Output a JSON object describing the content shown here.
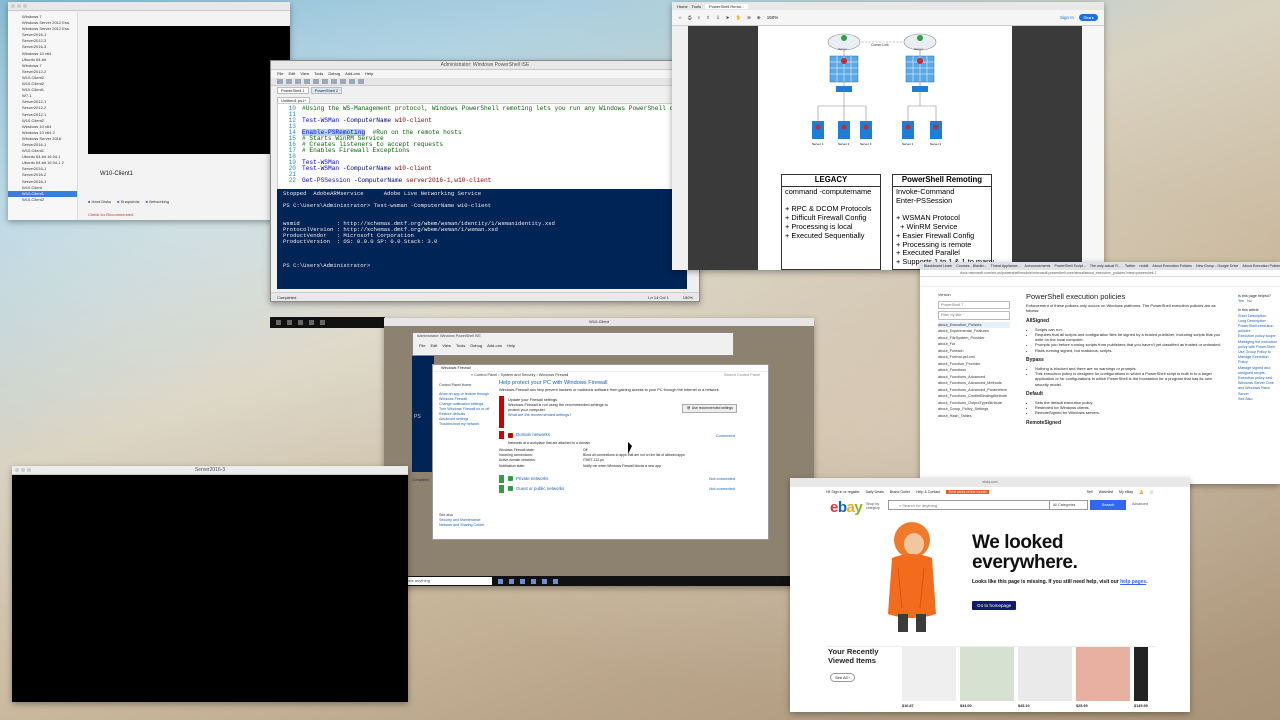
{
  "vm_manager": {
    "vm_list": [
      "Windows 7",
      "Windows Server 2012 Ess.",
      "Windows Server 2012 Ess.",
      "Server2016-1",
      "Server2012-3",
      "Server2016-3",
      "Windows 10 x64",
      "Ubuntu 64-bit",
      "Windows 7",
      "Server2012-2",
      "W10-Client2",
      "W10-Client2",
      "W10-Client1",
      "W7-1",
      "Server2012-1",
      "Server2012-2",
      "Server2012-1",
      "W10-Client2",
      "Windows 10 x64",
      "Windows 10 x64 2",
      "Windows Server 2016",
      "Server2016-1",
      "W10-Client1",
      "Ubuntu 64-bit 16.04.1",
      "Ubuntu 64-bit 16.04.1 2",
      "Server2016-1",
      "Server2016-2",
      "Server2016-1",
      "W10-Client",
      "W10-Client1",
      "W10-Client2"
    ],
    "selected_index": 29,
    "selected_vm": "W10-Client1",
    "details": [
      "Hard Disks",
      "Snapshots",
      "Networking"
    ],
    "details_note": "Check for Recommended"
  },
  "ps_ise": {
    "title": "Administrator: Windows PowerShell ISE",
    "menu": [
      "File",
      "Edit",
      "View",
      "Tools",
      "Debug",
      "Add-ons",
      "Help"
    ],
    "tabs": [
      "PowerShell 1",
      "PowerShell 2"
    ],
    "file_tab": "Untitled1.ps1*",
    "script_lines": [
      {
        "no": "10",
        "parts": [
          {
            "t": "#Using the WS-Management protocol, Windows PowerShell remoting lets you run any Windows PowerShell command on one",
            "c": "cm"
          }
        ]
      },
      {
        "no": "11",
        "parts": []
      },
      {
        "no": "12",
        "parts": [
          {
            "t": "Test-WSMan",
            "c": "cmd"
          },
          {
            "t": " -ComputerName ",
            "c": "par"
          },
          {
            "t": "w10-client",
            "c": "str"
          }
        ]
      },
      {
        "no": "13",
        "parts": []
      },
      {
        "no": "14",
        "parts": [
          {
            "t": "Enable-PSRemoting",
            "c": "cmd hl"
          },
          {
            "t": "  #Run on the remote hosts",
            "c": "cm"
          }
        ]
      },
      {
        "no": "15",
        "parts": [
          {
            "t": "# Starts WinRM Service",
            "c": "cm"
          }
        ]
      },
      {
        "no": "16",
        "parts": [
          {
            "t": "# Creates listeners to accept requests",
            "c": "cm"
          }
        ]
      },
      {
        "no": "17",
        "parts": [
          {
            "t": "# Enables Firewall Exceptions",
            "c": "cm"
          }
        ]
      },
      {
        "no": "18",
        "parts": []
      },
      {
        "no": "19",
        "parts": [
          {
            "t": "Test-WSMan",
            "c": "cmd"
          }
        ]
      },
      {
        "no": "20",
        "parts": [
          {
            "t": "Test-WSMan",
            "c": "cmd"
          },
          {
            "t": " -ComputerName ",
            "c": "par"
          },
          {
            "t": "w10-client",
            "c": "str"
          }
        ]
      },
      {
        "no": "21",
        "parts": []
      },
      {
        "no": "22",
        "parts": [
          {
            "t": "Get-PSSession",
            "c": "cmd"
          },
          {
            "t": " -ComputerName ",
            "c": "par"
          },
          {
            "t": "server2016-1,w10-client",
            "c": "str"
          }
        ]
      }
    ],
    "console": "Stopped  AdobeARMservice      Adobe Live Networking Service\n\nPS C:\\Users\\Administrator> Test-wsman -ComputerName w10-client\n\n\nwsmid           : http://schemas.dmtf.org/wbem/wsman/identity/1/wsmanidentity.xsd\nProtocolVersion : http://schemas.dmtf.org/wbem/wsman/1/wsman.xsd\nProductVendor   : Microsoft Corporation\nProductVersion  : OS: 0.0.0 SP: 0.0 Stack: 3.0\n\n\n\nPS C:\\Users\\Administrator> ",
    "status_left": "Completed",
    "status_pos": "Ln 14  Col 1",
    "status_zoom": "150%"
  },
  "pdf": {
    "tabs": [
      "Home",
      "Tools",
      "PowerShell Remo..."
    ],
    "zoom": "150%",
    "sign_in": "Sign In",
    "share": "Share",
    "diagram_labels": {
      "center_link": "Comm Link",
      "server_left": "Server",
      "server_right": "Server",
      "legacy_servers": [
        "Server 1",
        "Server 2",
        "Server 3"
      ],
      "ps_servers": [
        "Server 1",
        "Server 2"
      ]
    },
    "legacy": {
      "title": "LEGACY",
      "lines": [
        "command -computername",
        "",
        "+ RPC & DCOM Protocols",
        "+ Difficult Firewall Config",
        "+ Processing is local",
        "+ Executed Sequentially"
      ]
    },
    "psremoting": {
      "title": "PowerShell Remoting",
      "lines": [
        "Invoke-Command",
        "Enter-PSSession",
        "",
        "+ WSMAN Protocol",
        "  + WinRM Service",
        "+ Easier Firewall Config",
        "+ Processing is remote",
        "+ Executed Parallel",
        "+ Supports 1 to 1 & 1 to many"
      ]
    }
  },
  "docs": {
    "tabs": [
      "Blackboard Learn",
      "Courses - Blackb...",
      "Threat Appliance...",
      "Announcements",
      "PowerShell Script...",
      "The only actual R...",
      "Twitter",
      "reddit",
      "About Execution Policies",
      "New Group - Google Drive",
      "About Execution Policies -"
    ],
    "url": "docs.microsoft.com/en-us/powershell/module/microsoft.powershell.core/about/about_execution_policies?view=powershell-7",
    "nav_version_label": "Version",
    "nav_version": "PowerShell 7",
    "nav_filter": "Filter by title",
    "nav_items": [
      "about_Execution_Policies",
      "about_Experimental_Features",
      "about_FileSystem_Provider",
      "about_For",
      "about_Foreach",
      "about_Format.ps1xml",
      "about_Function_Provider",
      "about_Functions",
      "about_Functions_Advanced",
      "about_Functions_Advanced_Methods",
      "about_Functions_Advanced_Parameters",
      "about_Functions_CmdletBindingAttribute",
      "about_Functions_OutputTypeAttribute",
      "about_Group_Policy_Settings",
      "about_Hash_Tables"
    ],
    "nav_selected": 0,
    "title": "PowerShell execution policies",
    "intro": "Enforcement of these policies only occurs on Windows platforms. The PowerShell execution policies are as follows:",
    "sections": [
      {
        "h": "AllSigned",
        "items": [
          "Scripts can run.",
          "Requires that all scripts and configuration files be signed by a trusted publisher, including scripts that you write on the local computer.",
          "Prompts you before running scripts from publishers that you haven't yet classified as trusted or untrusted.",
          "Risks running signed, but malicious, scripts."
        ]
      },
      {
        "h": "Bypass",
        "items": [
          "Nothing is blocked and there are no warnings or prompts.",
          "This execution policy is designed for configurations in which a PowerShell script is built in to a larger application or for configurations in which PowerShell is the foundation for a program that has its own security model."
        ]
      },
      {
        "h": "Default",
        "items": [
          "Sets the default execution policy.",
          "Restricted for Windows clients.",
          "RemoteSigned for Windows servers."
        ]
      },
      {
        "h": "RemoteSigned",
        "items": []
      }
    ],
    "right_header": "Is this page helpful?",
    "right_yes": "Yes",
    "right_no": "No",
    "right_title": "In this article",
    "right_items": [
      "Short Description",
      "Long Description",
      "PowerShell execution policies",
      "Execution policy scope",
      "Managing the execution policy with PowerShell",
      "Use Group Policy to Manage Execution Policy",
      "Manage signed and unsigned scripts",
      "Execution policy and Windows Server Core and Windows Nano Server",
      "See Also"
    ]
  },
  "firewall": {
    "vm_title": "W10-Client",
    "inner_title": "Administrator: Windows PowerShell ISE",
    "inner_menu": [
      "File",
      "Edit",
      "View",
      "Tools",
      "Debug",
      "Add-ons",
      "Help"
    ],
    "inner_tab": "Untitled1.ps1*",
    "inner_status": "Completed",
    "window_title": "Windows Firewall",
    "breadcrumb": "« Control Panel  ›  System and Security  ›  Windows Firewall",
    "search_placeholder": "Search Control Panel",
    "left_header": "Control Panel Home",
    "left_links": [
      "Allow an app or feature through Windows Firewall",
      "Change notification settings",
      "Turn Windows Firewall on or off",
      "Restore defaults",
      "Advanced settings",
      "Troubleshoot my network"
    ],
    "see_also": [
      "See also",
      "Security and Maintenance",
      "Network and Sharing Center"
    ],
    "heading": "Help protect your PC with Windows Firewall",
    "intro": "Windows Firewall can help prevent hackers or malicious software from gaining access to your PC through the Internet or a network.",
    "warn_title": "Update your Firewall settings",
    "warn_text": "Windows Firewall is not using the recommended settings to protect your computer.",
    "warn_link": "What are the recommended settings?",
    "warn_button": "Use recommended settings",
    "domain": {
      "label": "Domain networks",
      "state": "Connected"
    },
    "domain_desc": "Networks at a workplace that are attached to a domain",
    "props": [
      {
        "k": "Windows Firewall state:",
        "v": "Off"
      },
      {
        "k": "Incoming connections:",
        "v": "Block all connections to apps that are not on the list of allowed apps"
      },
      {
        "k": "Active domain networks:",
        "v": "ITNET-112.pri"
      },
      {
        "k": "Notification state:",
        "v": "Notify me when Windows Firewall blocks a new app"
      }
    ],
    "private": {
      "label": "Private networks",
      "state": "Not connected"
    },
    "public": {
      "label": "Guest or public networks",
      "state": "Not connected"
    },
    "taskbar_search": "Ask me anything",
    "clock_time": "10:00 AM",
    "clock_date": "5/1/2020"
  },
  "black_vm": {
    "title": "Server2016-3"
  },
  "ebay": {
    "url": "ebay.com",
    "topnav_left": [
      "Hi! Sign in or register",
      "Daily Deals",
      "Brand Outlet",
      "Help & Contact"
    ],
    "promo": "Best picks of the month",
    "topnav_right": [
      "Sell",
      "Watchlist",
      "My eBay"
    ],
    "logo": [
      "e",
      "b",
      "a",
      "y"
    ],
    "shop_by": "Shop by",
    "shop_by_2": "category",
    "search_placeholder": "Search for anything",
    "category": "All Categories",
    "search_button": "Search",
    "advanced": "Advanced",
    "headline_1": "We looked",
    "headline_2": "everywhere.",
    "message": "Looks like this page is missing. If you still need help, visit our ",
    "help_link": "help pages",
    "home_button": "Go to homepage",
    "recent_title": "Your Recently Viewed Items",
    "see_all": "See All",
    "prices": [
      "$16.87",
      "$34.00",
      "$45.10",
      "$25.99",
      "$149.99"
    ],
    "thumb_colors": [
      "#efefef",
      "#d7e1d1",
      "#eaeaea",
      "#e8b0a0",
      "#222222"
    ]
  }
}
